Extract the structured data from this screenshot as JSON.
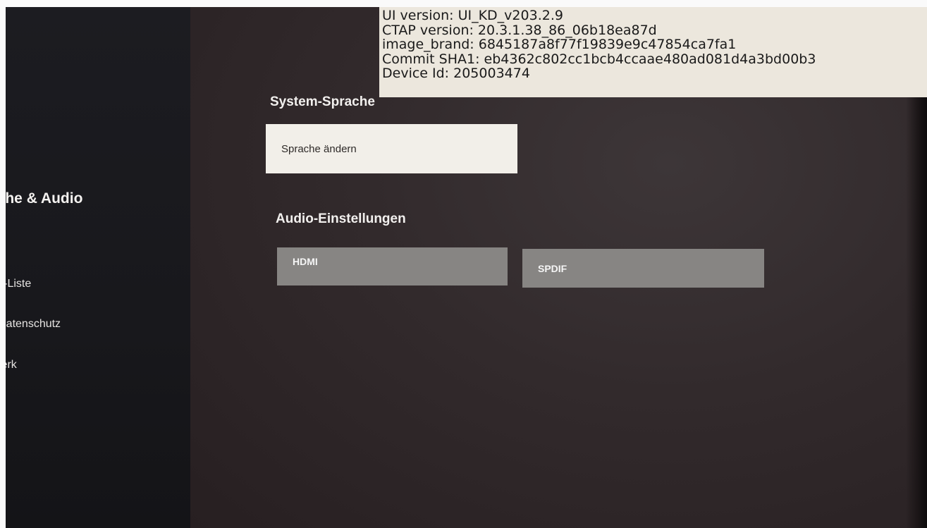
{
  "sidebar": {
    "heading": "ache & Audio",
    "items": [
      {
        "label": "der-Liste"
      },
      {
        "label": "& Datenschutz"
      },
      {
        "label": "zwerk"
      }
    ]
  },
  "system_language": {
    "title": "System-Sprache",
    "change_button_label": "Sprache ändern"
  },
  "audio_settings": {
    "title": "Audio-Einstellungen",
    "hdmi_label": "HDMI",
    "spdif_label": "SPDIF"
  },
  "debug_overlay": {
    "ui_version": "UI version: UI_KD_v203.2.9",
    "ctap_version": "CTAP version: 20.3.1.38_86_06b18ea87d",
    "image_brand": "image_brand: 6845187a8f77f19839e9c47854ca7fa1",
    "commit_sha1": "Commit SHA1: eb4362c802cc1bcb4ccaae480ad081d4a3bd00b3",
    "device_id": "Device Id: 205003474"
  },
  "colors": {
    "selected_button_bg": "#f2efe9",
    "unselected_button_bg": "#878583",
    "sidebar_bg": "#1c1c21",
    "content_bg": "#322a2c",
    "overlay_bg": "#ece7dd"
  }
}
